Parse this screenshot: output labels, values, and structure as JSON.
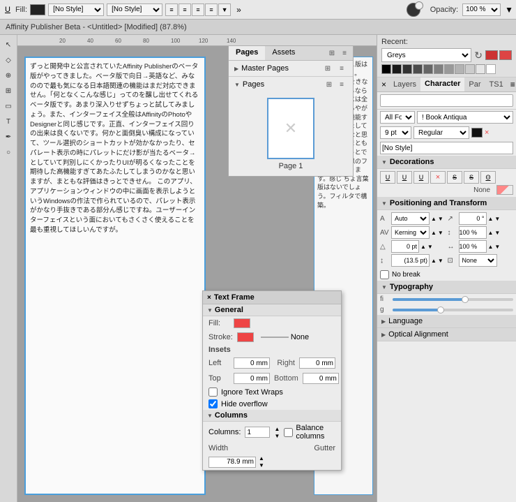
{
  "app": {
    "title": "Affinity Publisher Beta - <Untitled> [Modified] (87.8%)"
  },
  "toolbar": {
    "underline_label": "U",
    "fill_label": "Fill:",
    "no_style_1": "[No Style]",
    "no_style_2": "[No Style]",
    "more_label": "»"
  },
  "color_panel": {
    "opacity_label": "Opacity:",
    "opacity_value": "100 %"
  },
  "pages_panel": {
    "title": "Pages",
    "assets_tab": "Assets",
    "master_pages_label": "Master Pages",
    "pages_label": "Pages",
    "page_label": "Page 1"
  },
  "right_panel": {
    "recent_label": "Recent:",
    "palette_name": "Greys",
    "tabs": [
      "×",
      "Layers",
      "Character",
      "Par",
      "TS1",
      "≡"
    ],
    "search_placeholder": "",
    "font_prefix": "All Fonts",
    "font_name": "! Book Antiqua",
    "font_size": "9 pt",
    "font_style": "Regular",
    "style_label": "[No Style]",
    "decorations_label": "Decorations",
    "deco_buttons": [
      "U",
      "U",
      "U",
      "S",
      "S",
      "Θ"
    ],
    "none_label": "None",
    "positioning_label": "Positioning and Transform",
    "auto_label": "Auto",
    "kerning_label": "Kerning",
    "pos_angle": "0 °",
    "pos_pct1": "100 %",
    "pos_pt": "0 pt",
    "pos_pct2": "100 %",
    "pos_paren": "(13.5 pt)",
    "pos_none": "None",
    "no_break_label": "No break",
    "typography_label": "Typography",
    "language_label": "Language",
    "optical_label": "Optical Alignment"
  },
  "text_frame_panel": {
    "title": "Text Frame",
    "general_label": "General",
    "fill_label": "Fill:",
    "stroke_label": "Stroke:",
    "none_label": "None",
    "insets_label": "Insets",
    "left_label": "Left",
    "left_value": "0 mm",
    "right_label": "Right",
    "right_value": "0 mm",
    "top_label": "Top",
    "top_value": "0 mm",
    "bottom_label": "Bottom",
    "bottom_value": "0 mm",
    "ignore_text_wraps": "Ignore Text Wraps",
    "hide_overflow": "Hide overflow",
    "columns_label": "Columns",
    "columns_count": "1",
    "balance_columns": "Balance columns",
    "width_label": "Width",
    "gutter_label": "Gutter",
    "width_value": "78.9 mm"
  },
  "canvas_text_main": "ずっと開発中と公言されていたAffinity Publisherのベータ版がやってきました。ベータ版で向日→英語など、みなのので最も気になる日本語関連の機能はまだ対応できません。「何となくこんな感じ」ってのを醸し出せてくれるベータ版です。あまり深入りせずちょっと試してみましょう。また、インターフェイス全般はAffinityのPhotoやDesignerと同じ感じです。正直、インターフェイス回りの出来は良くないです。何かと面倒臭い構成になっていて、ツール選択のショートカットが効かなかったり、セパレート表示の時にパレットにだけ影が当たるベータ→としていて判別しにくかったりUIが明るくなったことを期待した高機能すぎてあたふたしてしまうのかなと思いますが、まともな評価はきっとできせん。 このアプリ、アプリケーションウィンドウの中に画面を表示しようというWindowsの作法で作られているので、パレット表示がかなり手抜きである部分ん感じですね。ユーザーインターフェイスという面においてもさくさく使えることを最も重視してほしいんですが。",
  "canvas_text_right": "に進道後のこ版はないでしょう。DTDアプリをきな目指しているならDTPアプリには全然詳しくあるやがぎそいは高機能すぎてあたふたしてしまうのかなと思いますが、まともな評価はきっとできせん。類似のフォルダのあります。感じ ちょ言葉版はないでしょう。フィルタで構築。",
  "swatches": [
    "#000000",
    "#1a1a1a",
    "#333333",
    "#4d4d4d",
    "#666666",
    "#808080",
    "#999999",
    "#b3b3b3",
    "#cccccc",
    "#e6e6e6",
    "#ffffff"
  ],
  "slider_positions": {
    "typo1": 60,
    "typo2": 40
  }
}
